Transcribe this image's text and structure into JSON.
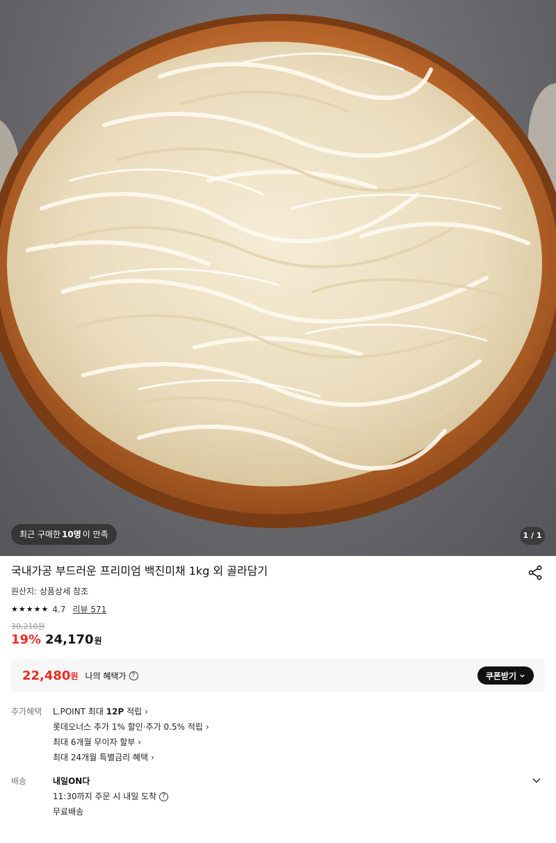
{
  "hero": {
    "recent_badge": {
      "prefix": "최근 구매한 ",
      "count": "10명",
      "suffix": "이 만족"
    },
    "page_indicator": "1 / 1"
  },
  "product": {
    "title": "국내가공 부드러운 프리미엄 백진미채 1kg 외 골라담기",
    "origin": "원산지: 상품상세 참조",
    "rating": "4.7",
    "rating_value": 4.7,
    "review_link": "리뷰 571",
    "original_price": "30,210원",
    "discount": "19%",
    "sale_price": "24,170",
    "won": "원"
  },
  "benefit": {
    "price": "22,480",
    "won": "원",
    "label": "나의 혜택가",
    "help": "?",
    "coupon_button": "쿠폰받기"
  },
  "extra_benefits": {
    "label": "추가혜택",
    "items": [
      {
        "prefix": "L.POINT 최대 ",
        "bold": "12P",
        "suffix": " 적립"
      },
      {
        "prefix": "롯데오너스 추가 1% 할인·추가 0.5% 적립",
        "bold": "",
        "suffix": ""
      },
      {
        "prefix": "최대 6개월 무이자 할부",
        "bold": "",
        "suffix": ""
      },
      {
        "prefix": "최대 24개월 특별금리 혜택",
        "bold": "",
        "suffix": ""
      }
    ]
  },
  "delivery": {
    "label": "배송",
    "title": "내일ON다",
    "cutoff": "11:30까지 주문 시 내일 도착",
    "help": "?",
    "fee": "무료배송"
  },
  "colors": {
    "accent_red": "#ef2a23",
    "text_primary": "#111111",
    "benefit_bg": "#f7f7f7",
    "coupon_bg": "#111111"
  },
  "icons": [
    "share-icon",
    "star-icon",
    "help-icon",
    "chevron-right-icon",
    "chevron-down-icon"
  ]
}
